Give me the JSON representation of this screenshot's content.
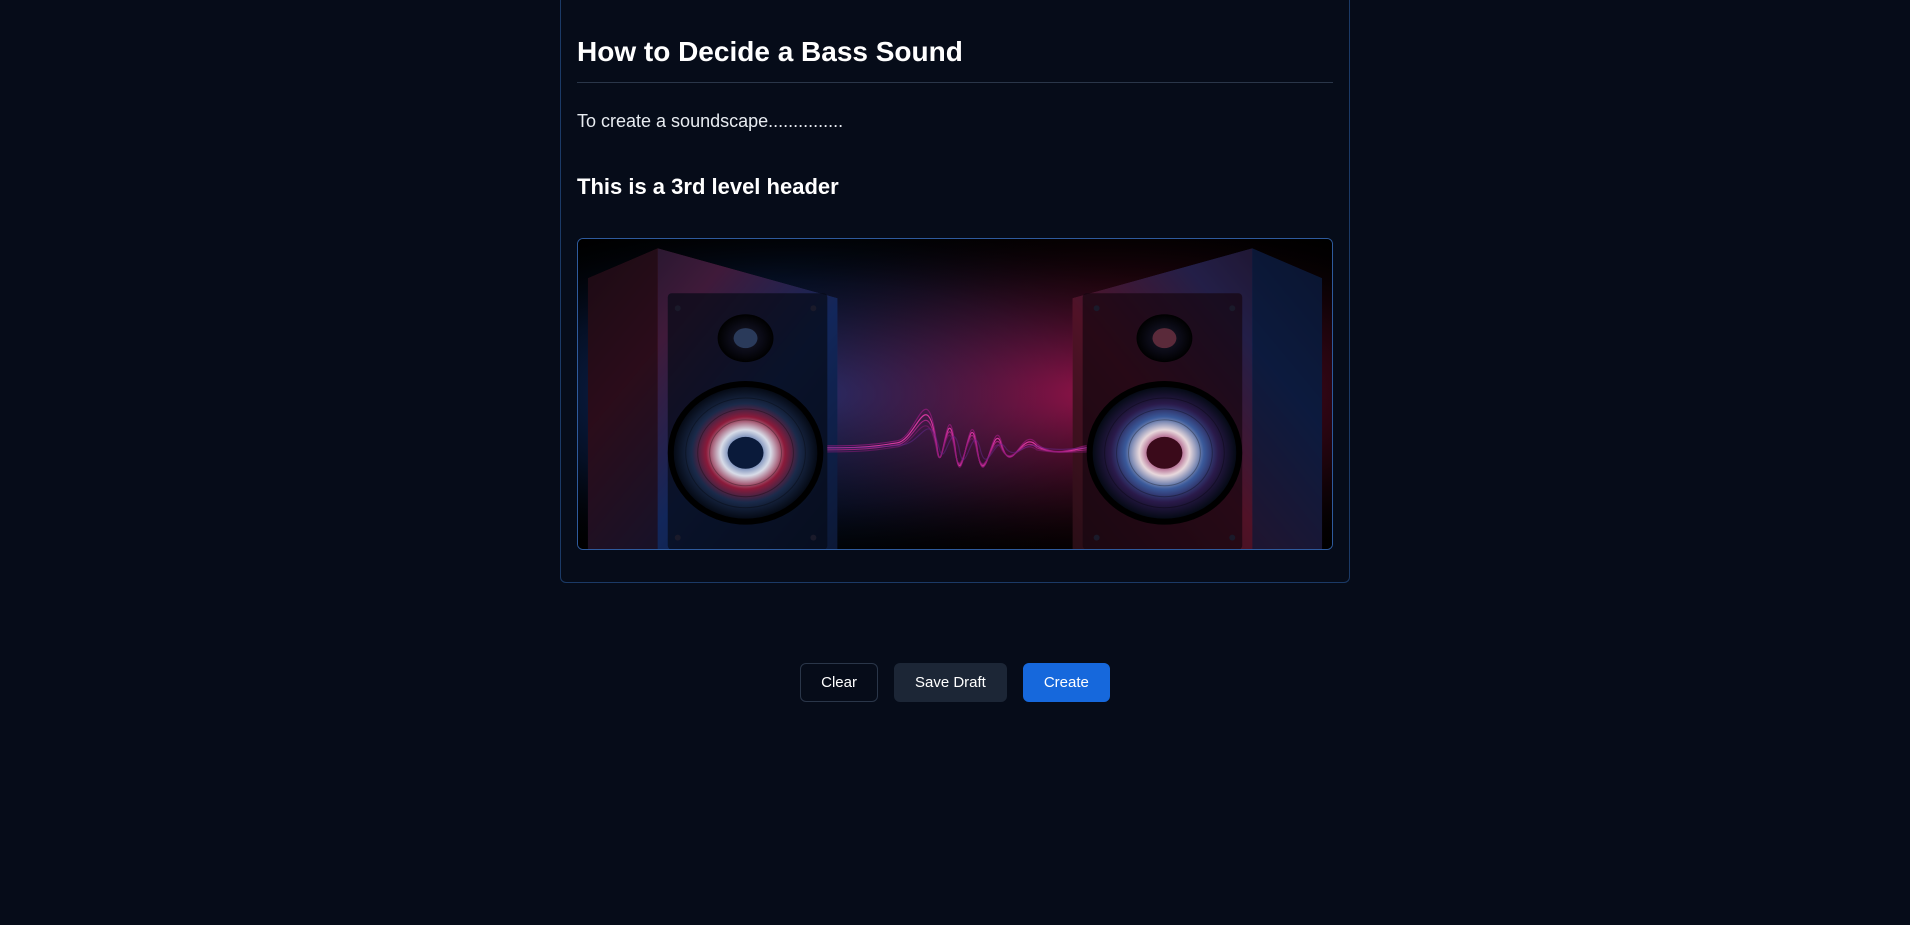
{
  "article": {
    "title": "How to Decide a Bass Sound",
    "paragraph": "To create a soundscape...............",
    "h3": "This is a 3rd level header"
  },
  "buttons": {
    "clear": "Clear",
    "save_draft": "Save Draft",
    "create": "Create"
  }
}
